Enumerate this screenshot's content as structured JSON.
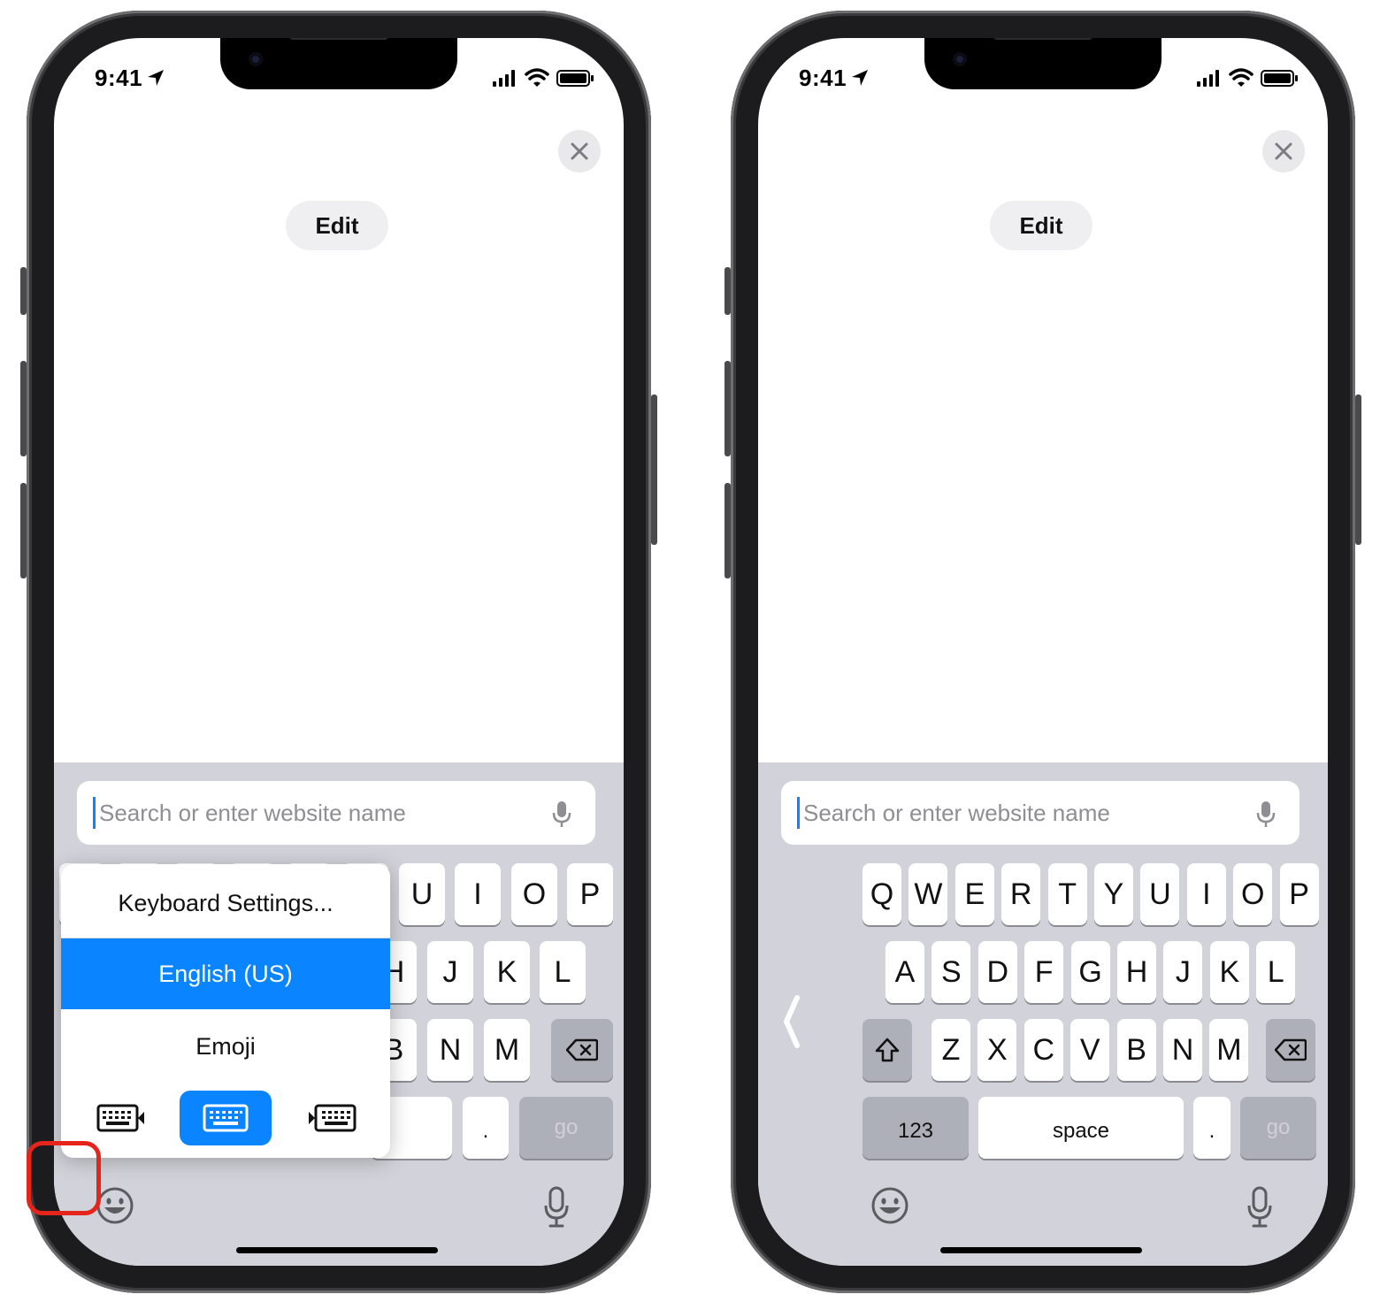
{
  "status_bar": {
    "time": "9:41"
  },
  "header": {
    "edit_label": "Edit"
  },
  "search": {
    "placeholder": "Search or enter website name"
  },
  "left_keyboard": {
    "row1_visible": [
      "U",
      "I",
      "O",
      "P"
    ],
    "row2_visible": [
      "H",
      "J",
      "K",
      "L"
    ],
    "row3_visible": [
      "B",
      "N",
      "M"
    ],
    "period": ".",
    "go_label": "go"
  },
  "popup": {
    "items": [
      "Keyboard Settings...",
      "English (US)",
      "Emoji"
    ],
    "selected_item": "English (US)",
    "modes": [
      "left-handed-keyboard",
      "full-keyboard",
      "right-handed-keyboard"
    ],
    "selected_mode": "full-keyboard",
    "accent": "#0A84FF"
  },
  "right_keyboard": {
    "row1": [
      "Q",
      "W",
      "E",
      "R",
      "T",
      "Y",
      "U",
      "I",
      "O",
      "P"
    ],
    "row2": [
      "A",
      "S",
      "D",
      "F",
      "G",
      "H",
      "J",
      "K",
      "L"
    ],
    "row3": [
      "Z",
      "X",
      "C",
      "V",
      "B",
      "N",
      "M"
    ],
    "numbers_label": "123",
    "space_label": "space",
    "period": ".",
    "go_label": "go"
  },
  "annotation": {
    "highlight_color": "#E5241B",
    "highlighted": "emoji-globe-icon"
  }
}
